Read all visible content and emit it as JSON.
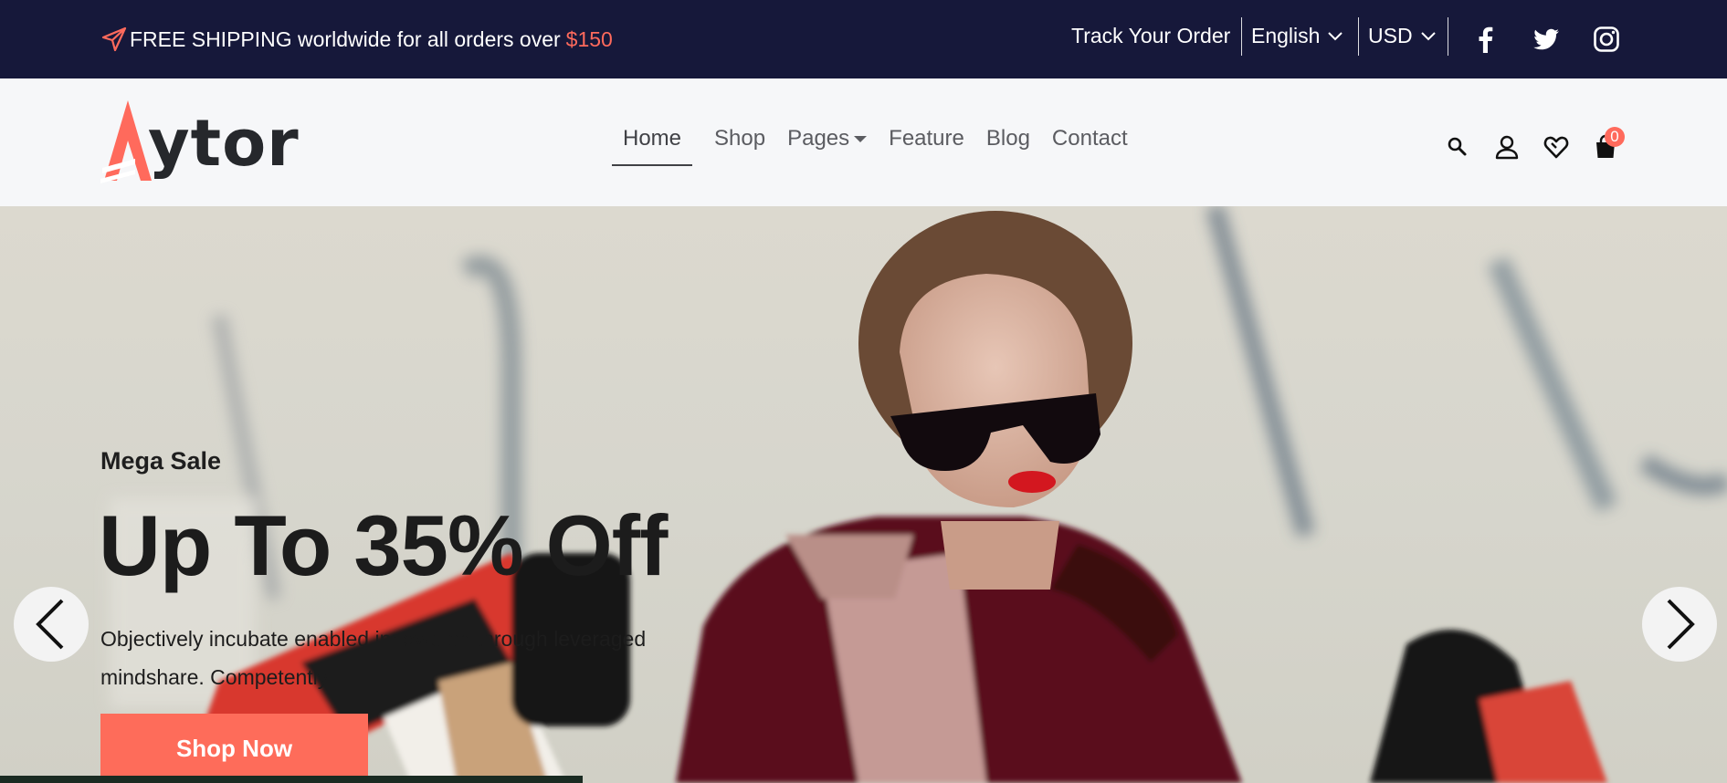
{
  "topbar": {
    "promo_text": "FREE SHIPPING worldwide for all orders over",
    "promo_price": "$150",
    "track_order": "Track Your Order",
    "language": "English",
    "currency": "USD",
    "social": [
      "facebook-icon",
      "twitter-icon",
      "instagram-icon"
    ]
  },
  "header": {
    "logo_text": "ytor",
    "nav": [
      "Home",
      "Shop",
      "Pages",
      "Feature",
      "Blog",
      "Contact"
    ],
    "active_nav": "Home",
    "icons": [
      "search-icon",
      "user-icon",
      "heart-icon",
      "cart-icon"
    ],
    "cart_count": "0"
  },
  "hero": {
    "kicker": "Mega Sale",
    "headline": "Up To 35% Off",
    "description": "Objectively incubate enabled innovation through leveraged mindshare. Competently.",
    "cta": "Shop Now"
  },
  "colors": {
    "topbar_bg": "#16183a",
    "accent": "#ff6a5c",
    "header_bg": "#f6f7f9"
  }
}
